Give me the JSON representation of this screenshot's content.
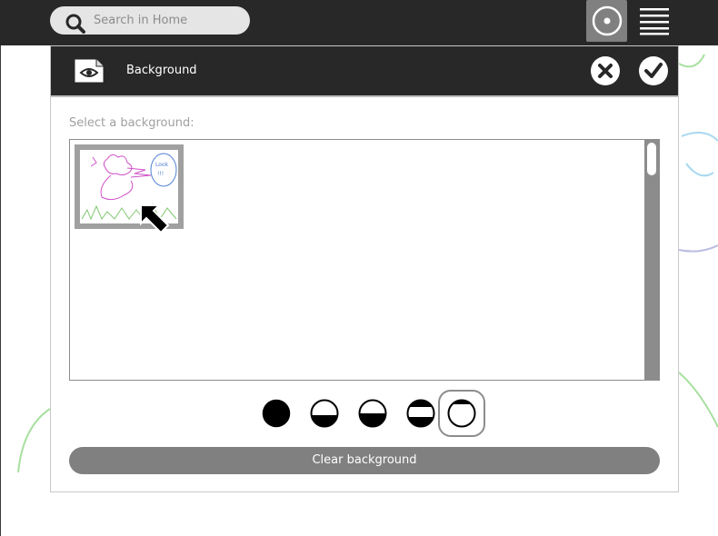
{
  "toolbar": {
    "search": {
      "placeholder": "Search in Home",
      "value": ""
    },
    "active_icon": "view-radial-icon",
    "menu_icon": "hamburger-menu-icon"
  },
  "dialog": {
    "title": "Background",
    "title_icon": "background-eye-icon",
    "cancel_icon": "cancel-icon",
    "accept_icon": "accept-icon",
    "prompt": "Select a background:",
    "thumbnails": [
      {
        "name": "drawing-thumbnail"
      }
    ],
    "opacity_options": [
      {
        "name": "opacity-100",
        "fill_fraction": 1.0
      },
      {
        "name": "opacity-75",
        "fill_fraction": 0.5
      },
      {
        "name": "opacity-50",
        "fill_fraction": 0.35
      },
      {
        "name": "opacity-25",
        "fill_fraction": 0.2
      },
      {
        "name": "opacity-0",
        "fill_fraction": 0.0,
        "selected": true
      }
    ],
    "clear_label": "Clear background"
  },
  "colors": {
    "toolbar_bg": "#282828",
    "active_button": "#808080",
    "scrollbar": "#8c8c8c",
    "drawing_pink": "#d050c8",
    "drawing_green": "#80c870",
    "drawing_blue": "#5080d0"
  }
}
